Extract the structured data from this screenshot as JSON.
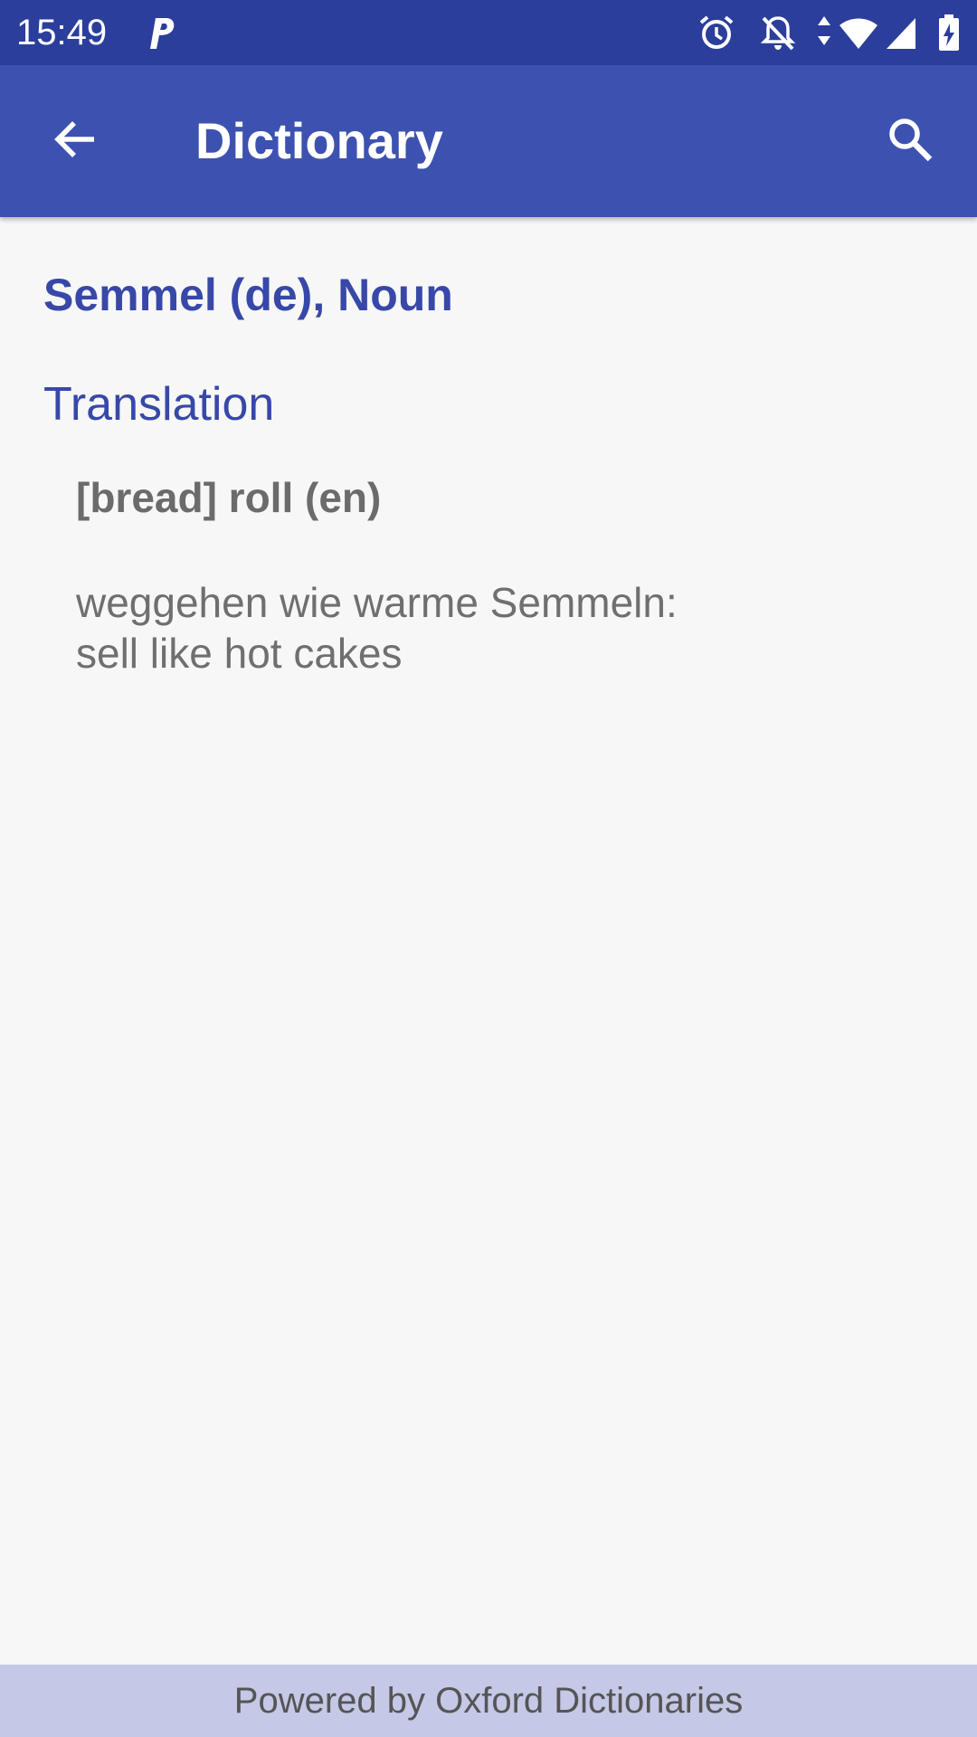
{
  "status_bar": {
    "time": "15:49",
    "icons": [
      "parking-notification-icon",
      "alarm-icon",
      "notifications-off-icon",
      "data-arrows-icon",
      "wifi-icon",
      "cell-signal-icon",
      "battery-charging-icon"
    ],
    "background": "#2c3e9b"
  },
  "app_bar": {
    "title": "Dictionary",
    "background": "#3d52b0",
    "back_icon": "arrow-back-icon",
    "search_icon": "search-icon"
  },
  "entry": {
    "headword": "Semmel (de), Noun",
    "section_title": "Translation",
    "translation": "[bread] roll (en)",
    "example_line1": "weggehen wie warme Semmeln:",
    "example_line2": "sell like hot cakes"
  },
  "footer": {
    "text": "Powered by Oxford Dictionaries",
    "background": "#c5c8e6"
  },
  "colors": {
    "accent": "#3848a8",
    "page_background": "#f6f7f6",
    "body_text": "#6b6b6b"
  }
}
